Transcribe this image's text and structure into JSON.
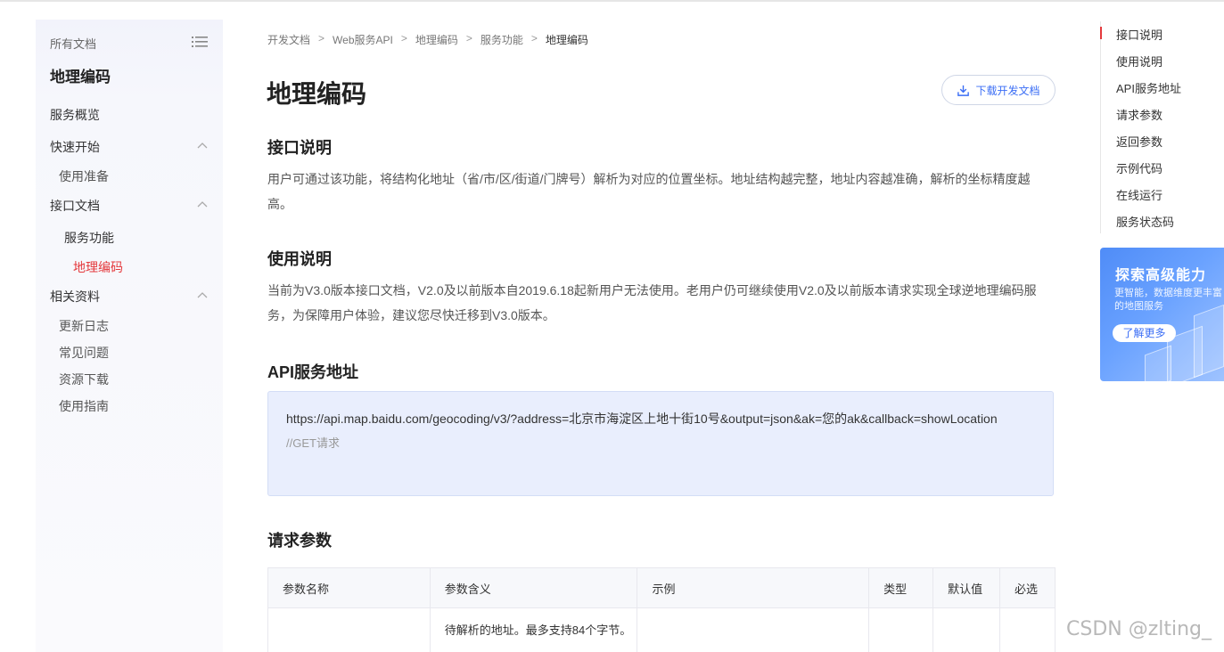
{
  "sidebar": {
    "header": "所有文档",
    "title": "地理编码",
    "items": [
      {
        "label": "服务概览"
      },
      {
        "label": "快速开始"
      },
      {
        "label": "使用准备"
      },
      {
        "label": "接口文档"
      },
      {
        "label": "服务功能"
      },
      {
        "label": "地理编码"
      },
      {
        "label": "相关资料"
      },
      {
        "label": "更新日志"
      },
      {
        "label": "常见问题"
      },
      {
        "label": "资源下载"
      },
      {
        "label": "使用指南"
      }
    ]
  },
  "breadcrumb": [
    "开发文档",
    "Web服务API",
    "地理编码",
    "服务功能",
    "地理编码"
  ],
  "breadcrumb_sep": ">",
  "main": {
    "title": "地理编码",
    "download_label": "下载开发文档",
    "sections": {
      "interface": {
        "heading": "接口说明",
        "text": "用户可通过该功能，将结构化地址（省/市/区/街道/门牌号）解析为对应的位置坐标。地址结构越完整，地址内容越准确，解析的坐标精度越高。"
      },
      "usage": {
        "heading": "使用说明",
        "text": "当前为V3.0版本接口文档，V2.0及以前版本自2019.6.18起新用户无法使用。老用户仍可继续使用V2.0及以前版本请求实现全球逆地理编码服务，为保障用户体验，建议您尽快迁移到V3.0版本。"
      },
      "api": {
        "heading": "API服务地址",
        "url": "https://api.map.baidu.com/geocoding/v3/?address=北京市海淀区上地十街10号&output=json&ak=您的ak&callback=showLocation",
        "comment": "//GET请求"
      },
      "params": {
        "heading": "请求参数",
        "columns": [
          "参数名称",
          "参数含义",
          "示例",
          "类型",
          "默认值",
          "必选"
        ],
        "rows": [
          [
            "",
            "待解析的地址。最多支持84个字节。",
            "",
            "",
            "",
            ""
          ]
        ]
      }
    }
  },
  "toc": {
    "items": [
      "接口说明",
      "使用说明",
      "API服务地址",
      "请求参数",
      "返回参数",
      "示例代码",
      "在线运行",
      "服务状态码"
    ]
  },
  "ad": {
    "title": "探索高级能力",
    "subtitle": "更智能，数据维度更丰富的地图服务",
    "button": "了解更多"
  },
  "watermark": "CSDN @zlting_",
  "colors": {
    "accent_red": "#e4393c",
    "link_blue": "#3b6ef5",
    "code_bg": "#e9eefd"
  }
}
